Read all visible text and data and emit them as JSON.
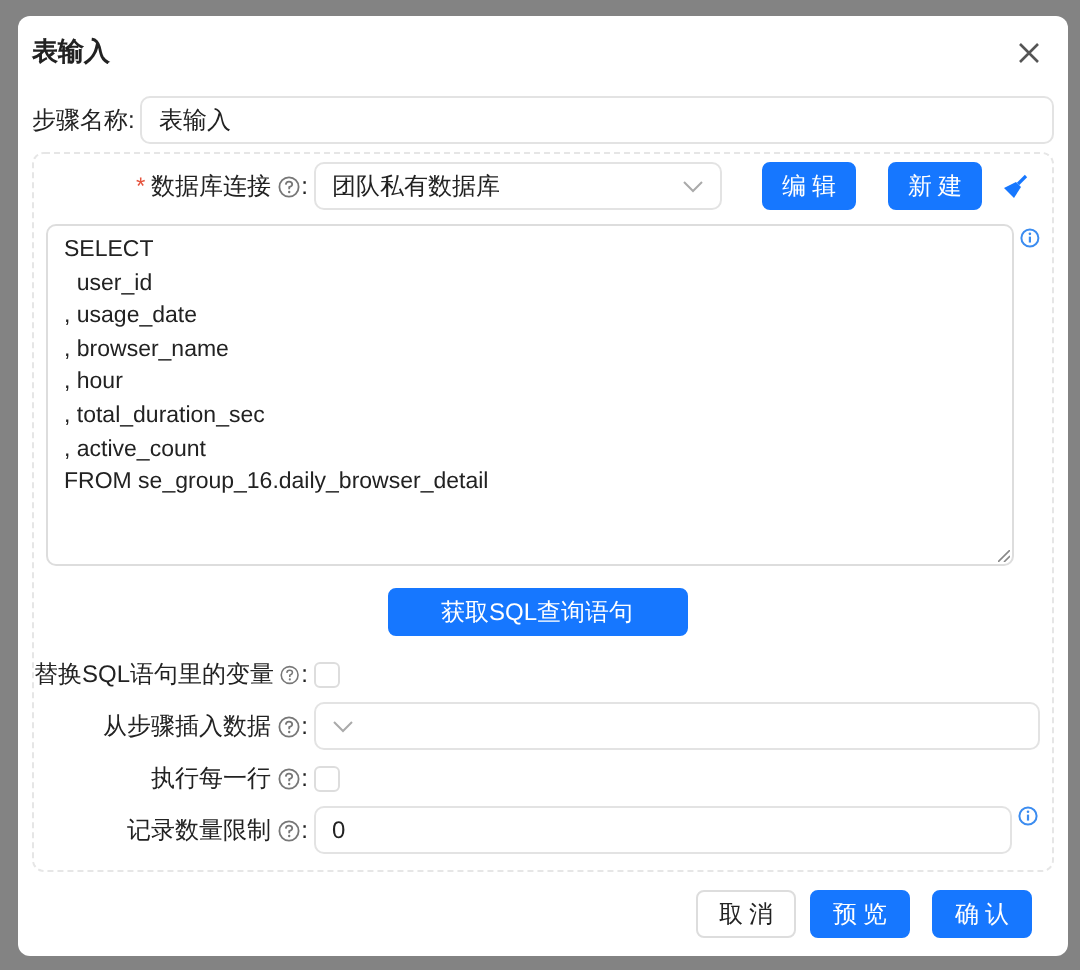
{
  "dialog": {
    "title": "表输入"
  },
  "step_name": {
    "label": "步骤名称:",
    "value": "表输入"
  },
  "connection": {
    "required_mark": "*",
    "label": "数据库连接",
    "suffix": ":",
    "value": "团队私有数据库",
    "buttons": [
      "编 辑",
      "新 建"
    ]
  },
  "sql": {
    "value": "SELECT\n  user_id\n, usage_date\n, browser_name\n, hour\n, total_duration_sec\n, active_count\nFROM se_group_16.daily_browser_detail"
  },
  "get_sql_button": "获取SQL查询语句",
  "options": [
    {
      "kind": "checkbox",
      "label": "替换SQL语句里的变量",
      "suffix": ":",
      "checked": false
    },
    {
      "kind": "select",
      "label": "从步骤插入数据",
      "suffix": ":"
    },
    {
      "kind": "checkbox",
      "label": "执行每一行",
      "suffix": ":",
      "checked": false
    },
    {
      "kind": "input",
      "label": "记录数量限制",
      "suffix": ":",
      "value": "0"
    }
  ],
  "footer_buttons": [
    {
      "label": "取 消",
      "kind": "default"
    },
    {
      "label": "预 览",
      "kind": "primary"
    },
    {
      "label": "确 认",
      "kind": "primary"
    }
  ]
}
